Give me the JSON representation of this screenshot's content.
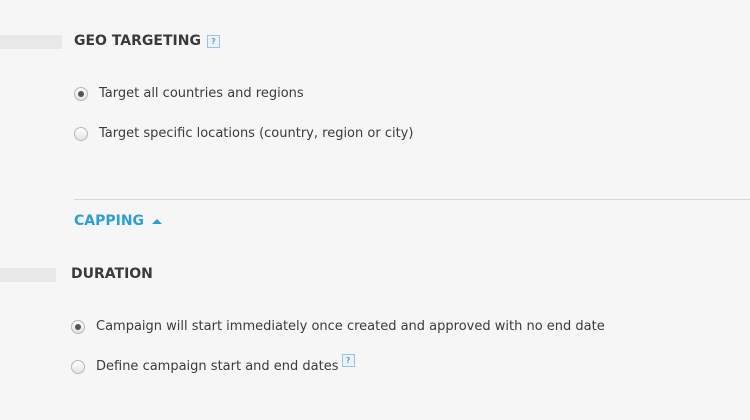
{
  "geo_targeting": {
    "title": "GEO TARGETING",
    "help_icon": "help-icon",
    "options": [
      {
        "label": "Target all countries and regions",
        "selected": true
      },
      {
        "label": "Target specific locations (country, region or city)",
        "selected": false
      }
    ]
  },
  "capping": {
    "label": "CAPPING",
    "icon": "caret-up-icon",
    "color": "#2a9fd6"
  },
  "duration": {
    "title": "DURATION",
    "options": [
      {
        "label": "Campaign will start immediately once created and approved with no end date",
        "selected": true
      },
      {
        "label": "Define campaign start and end dates",
        "selected": false,
        "help_icon": "help-icon"
      }
    ]
  }
}
